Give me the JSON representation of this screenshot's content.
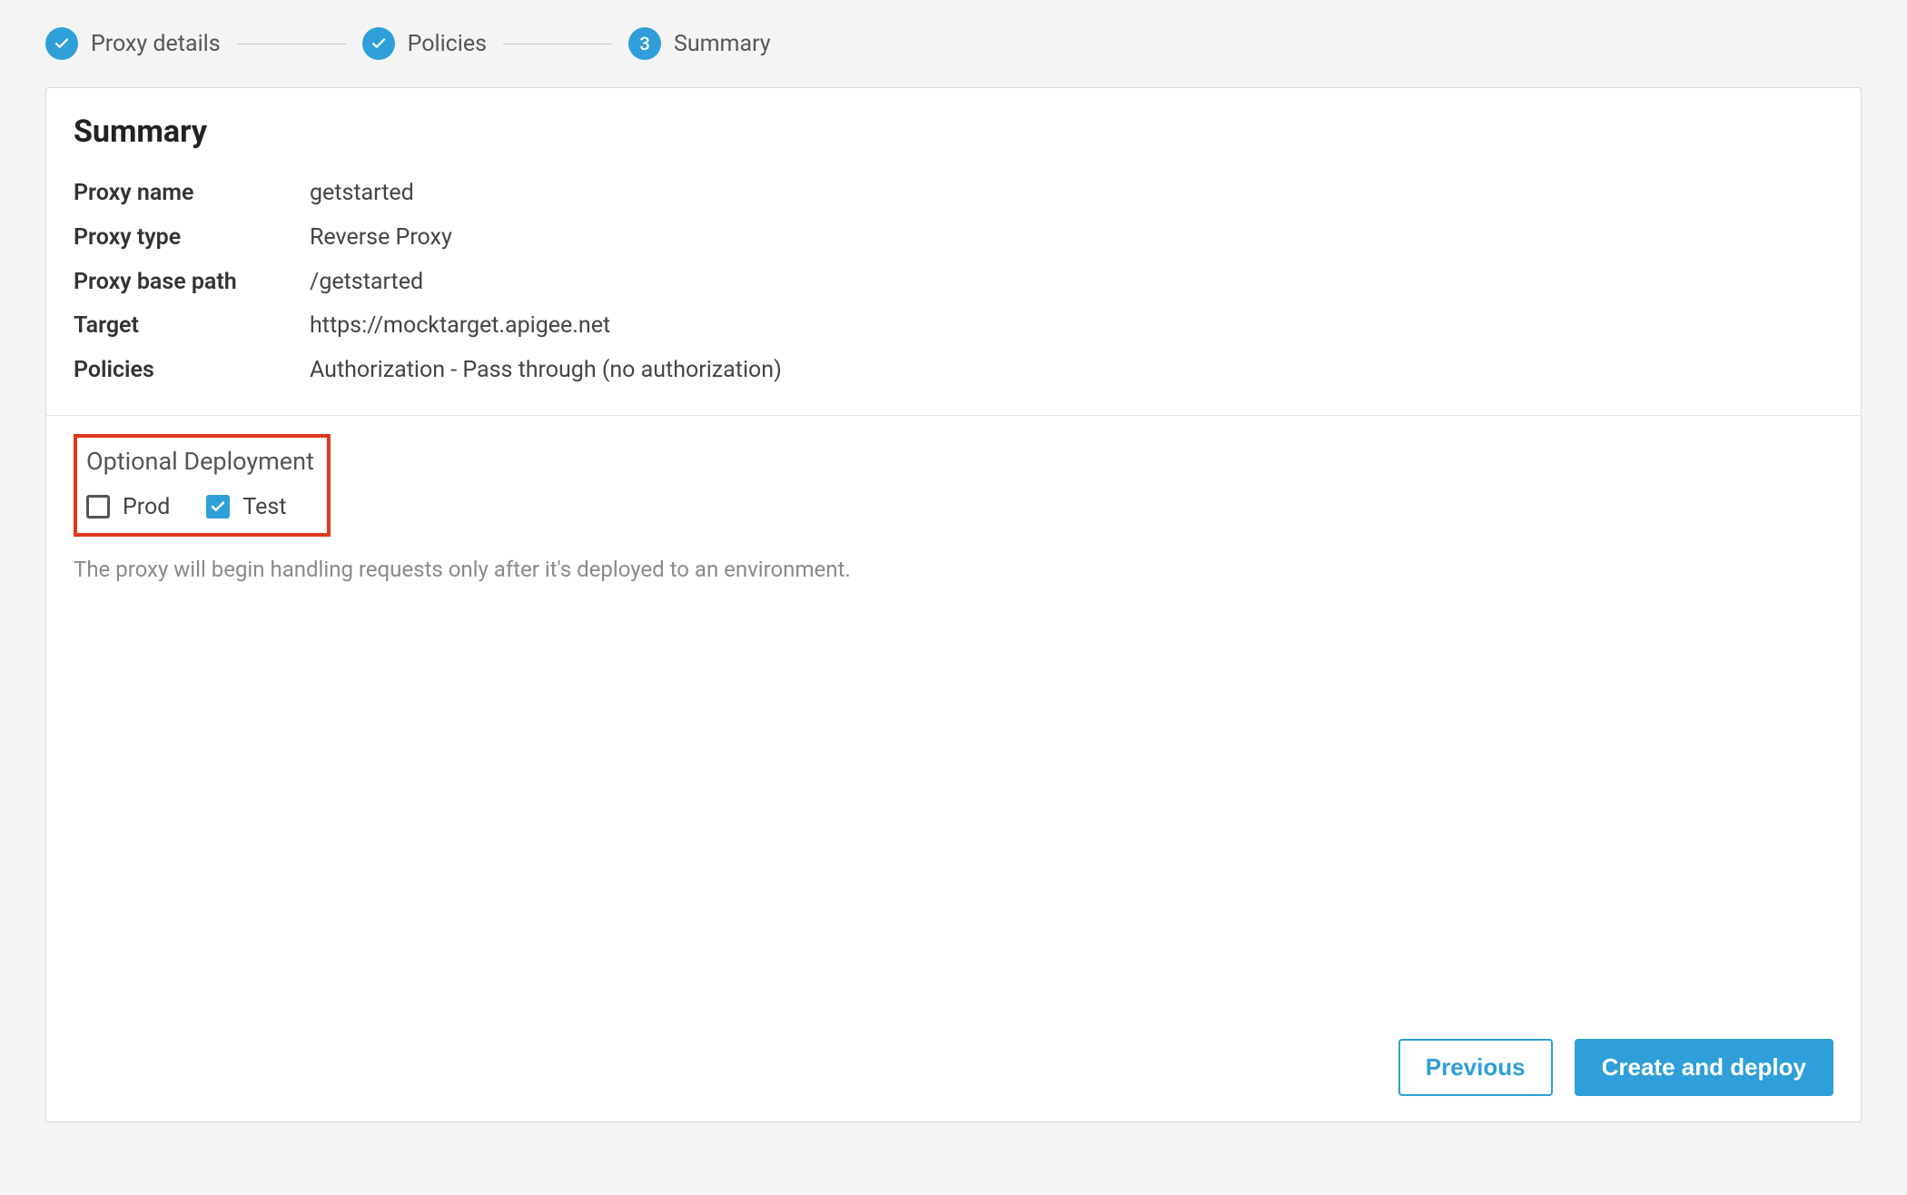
{
  "stepper": {
    "steps": [
      {
        "label": "Proxy details",
        "state": "done"
      },
      {
        "label": "Policies",
        "state": "done"
      },
      {
        "label": "Summary",
        "state": "current",
        "number": "3"
      }
    ]
  },
  "summary": {
    "title": "Summary",
    "rows": {
      "proxy_name": {
        "label": "Proxy name",
        "value": "getstarted"
      },
      "proxy_type": {
        "label": "Proxy type",
        "value": "Reverse Proxy"
      },
      "proxy_base_path": {
        "label": "Proxy base path",
        "value": "/getstarted"
      },
      "target": {
        "label": "Target",
        "value": "https://mocktarget.apigee.net"
      },
      "policies": {
        "label": "Policies",
        "value": "Authorization - Pass through (no authorization)"
      }
    }
  },
  "deployment": {
    "title": "Optional Deployment",
    "options": {
      "prod": {
        "label": "Prod",
        "checked": false
      },
      "test": {
        "label": "Test",
        "checked": true
      }
    },
    "hint": "The proxy will begin handling requests only after it's deployed to an environment."
  },
  "footer": {
    "previous": "Previous",
    "create_deploy": "Create and deploy"
  }
}
